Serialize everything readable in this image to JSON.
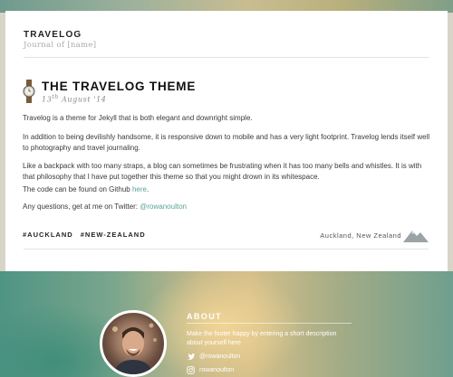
{
  "site": {
    "title": "TRAVELOG",
    "subtitle": "Journal of [name]"
  },
  "post": {
    "title": "THE TRAVELOG THEME",
    "date_day": "13",
    "date_suffix": "th",
    "date_rest": " August '14",
    "icon": "watch-icon",
    "paragraphs": {
      "p1": "Travelog is a theme for Jekyll that is both elegant and downright simple.",
      "p2": "In addition to being devilishly handsome, it is responsive down to mobile and has a very light footprint. Travelog lends itself well to photography and travel journaling.",
      "p3": "Like a backpack with too many straps, a blog can sometimes be frustrating when it has too many bells and whistles. It is with that philosophy that I have put together this theme so that you might drown in its whitespace.",
      "p4_before": "The code can be found on Github ",
      "p4_link": "here",
      "p4_after": ".",
      "p5_before": "Any questions, get at me on Twitter: ",
      "p5_link": "@rowanoulton"
    },
    "tags": [
      "#AUCKLAND",
      "#NEW-ZEALAND"
    ],
    "location": "Auckland, New Zealand"
  },
  "footer": {
    "about_heading": "ABOUT",
    "about_text": "Make the footer happy by entering a short description about yourself here",
    "twitter_handle": "@rowanoulton",
    "instagram_handle": "rowanoulton"
  },
  "colors": {
    "link": "#5aa396",
    "footer_text": "#ffffff"
  }
}
